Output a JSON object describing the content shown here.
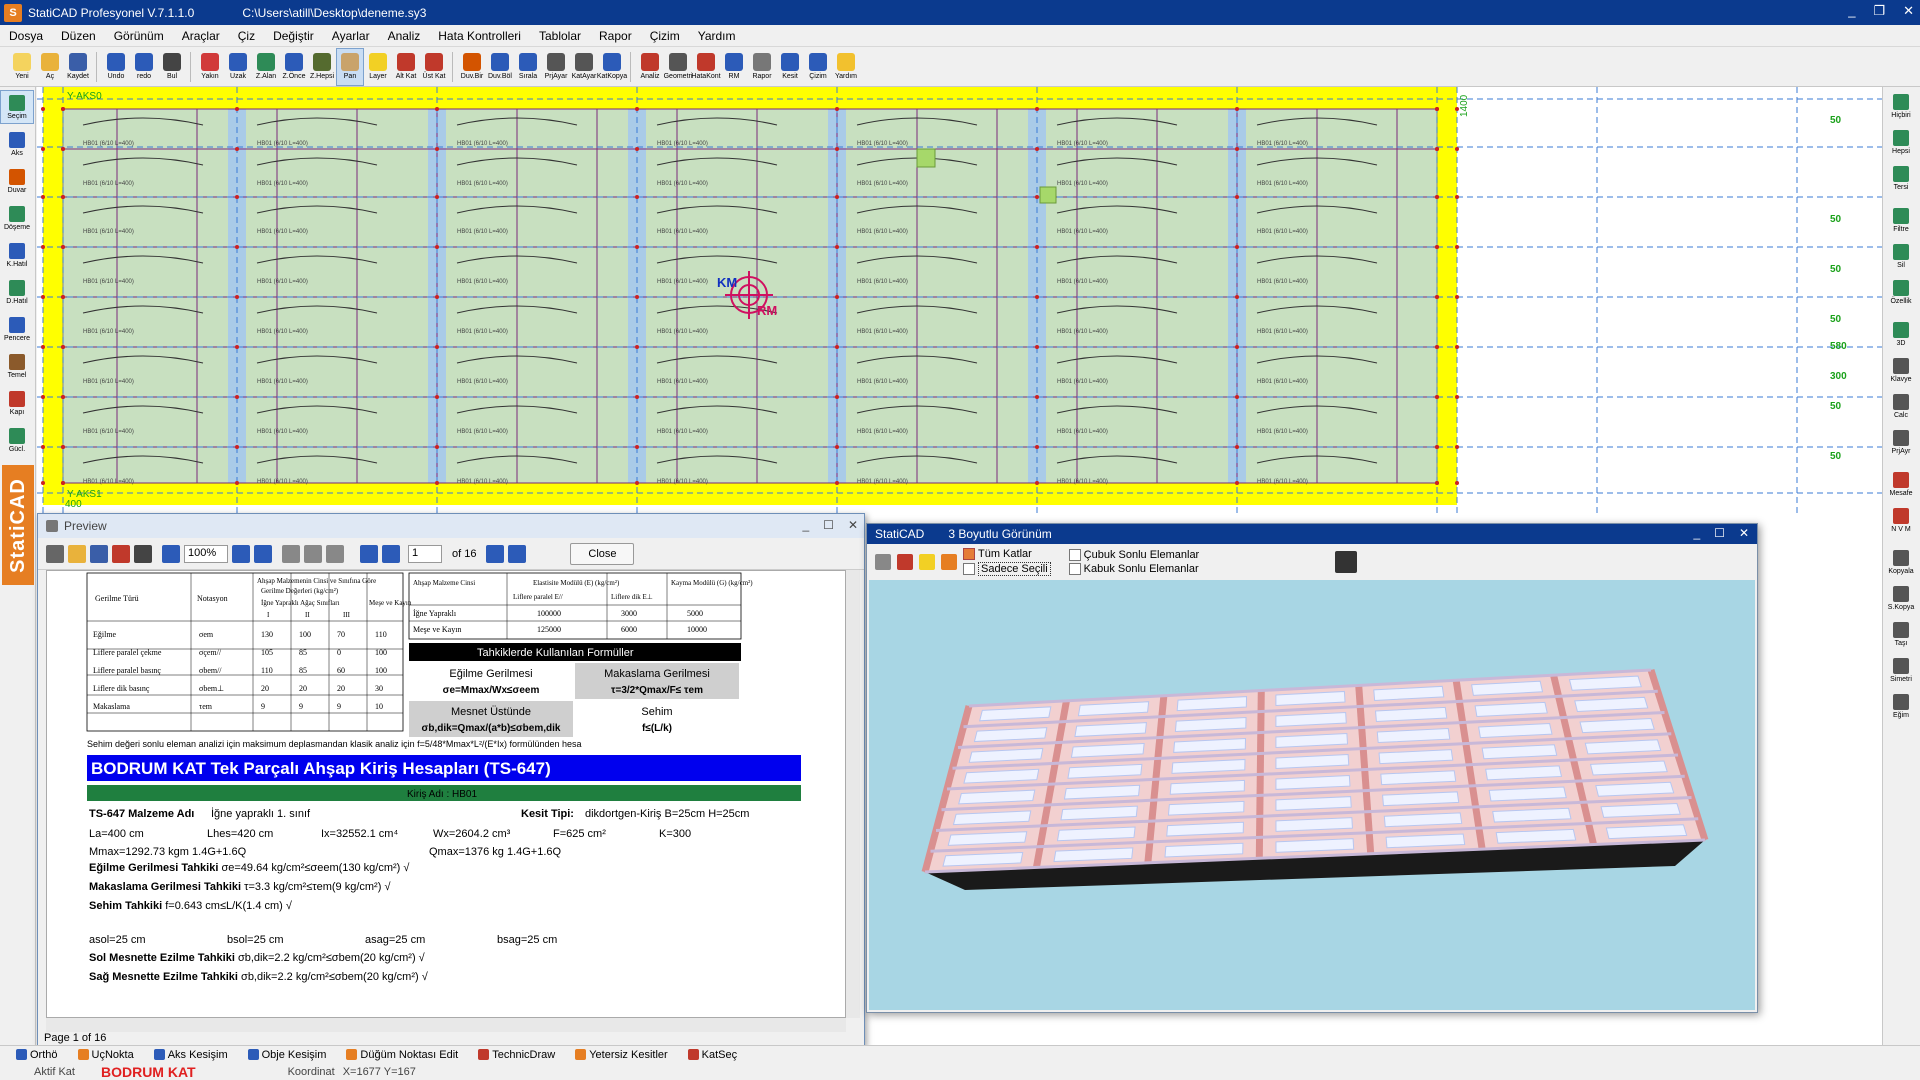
{
  "window": {
    "app_title": "StatiCAD Profesyonel V.7.1.1.0",
    "file_path": "C:\\Users\\atill\\Desktop\\deneme.sy3"
  },
  "menu": [
    "Dosya",
    "Düzen",
    "Görünüm",
    "Araçlar",
    "Çiz",
    "Değiştir",
    "Ayarlar",
    "Analiz",
    "Hata Kontrolleri",
    "Tablolar",
    "Rapor",
    "Çizim",
    "Yardım"
  ],
  "toolbar": [
    {
      "label": "Yeni",
      "icon": "new-file-icon",
      "color": "#f4d35e"
    },
    {
      "label": "Aç",
      "icon": "open-folder-icon",
      "color": "#e9b23b"
    },
    {
      "label": "Kaydet",
      "icon": "save-disk-icon",
      "color": "#3a5ea8"
    },
    {
      "label": "Undo",
      "icon": "undo-icon",
      "color": "#2c5bb8"
    },
    {
      "label": "redo",
      "icon": "redo-icon",
      "color": "#2c5bb8"
    },
    {
      "label": "Bul",
      "icon": "find-icon",
      "color": "#444444"
    },
    {
      "label": "Yakın",
      "icon": "zoom-in-icon",
      "color": "#d13a3a"
    },
    {
      "label": "Uzak",
      "icon": "zoom-out-icon",
      "color": "#2c5bb8"
    },
    {
      "label": "Z.Alan",
      "icon": "zoom-area-icon",
      "color": "#2e8b57"
    },
    {
      "label": "Z.Önce",
      "icon": "zoom-previous-icon",
      "color": "#2c5bb8"
    },
    {
      "label": "Z.Hepsi",
      "icon": "zoom-all-icon",
      "color": "#556b2f"
    },
    {
      "label": "Pan",
      "icon": "pan-hand-icon",
      "color": "#c9a36b"
    },
    {
      "label": "Layer",
      "icon": "layer-bulb-icon",
      "color": "#f2d024"
    },
    {
      "label": "Alt Kat",
      "icon": "lower-floor-icon",
      "color": "#c0392b"
    },
    {
      "label": "Üst Kat",
      "icon": "upper-floor-icon",
      "color": "#c0392b"
    },
    {
      "label": "Duv.Bir",
      "icon": "wall-join-icon",
      "color": "#d35400"
    },
    {
      "label": "Duv.Böl",
      "icon": "wall-split-icon",
      "color": "#2c5bb8"
    },
    {
      "label": "Sırala",
      "icon": "sort-icon",
      "color": "#2c5bb8"
    },
    {
      "label": "PrjAyar",
      "icon": "project-settings-icon",
      "color": "#555555"
    },
    {
      "label": "KatAyar",
      "icon": "floor-settings-icon",
      "color": "#555555"
    },
    {
      "label": "KatKopya",
      "icon": "floor-copy-icon",
      "color": "#2c5bb8"
    },
    {
      "label": "Analiz",
      "icon": "analysis-icon",
      "color": "#c0392b"
    },
    {
      "label": "Geometri",
      "icon": "geometry-icon",
      "color": "#555555"
    },
    {
      "label": "HataKont",
      "icon": "error-check-icon",
      "color": "#c0392b"
    },
    {
      "label": "RM",
      "icon": "rigidity-center-icon",
      "color": "#2c5bb8"
    },
    {
      "label": "Rapor",
      "icon": "report-icon",
      "color": "#777777"
    },
    {
      "label": "Kesit",
      "icon": "section-icon",
      "color": "#2c5bb8"
    },
    {
      "label": "Çizim",
      "icon": "drawing-icon",
      "color": "#2c5bb8"
    },
    {
      "label": "Yardım",
      "icon": "help-icon",
      "color": "#f2c12e"
    }
  ],
  "left_tools": [
    {
      "label": "Seçim",
      "icon": "select-icon",
      "color": "#2e8b57"
    },
    {
      "label": "Aks",
      "icon": "axis-icon",
      "color": "#2c5bb8"
    },
    {
      "label": "Duvar",
      "icon": "wall-icon",
      "color": "#d35400"
    },
    {
      "label": "Döşeme",
      "icon": "slab-icon",
      "color": "#2e8b57"
    },
    {
      "label": "K.Hatıl",
      "icon": "lintel-icon",
      "color": "#2c5bb8"
    },
    {
      "label": "D.Hatıl",
      "icon": "vertical-tie-icon",
      "color": "#2e8b57"
    },
    {
      "label": "Pencere",
      "icon": "window-icon",
      "color": "#2c5bb8"
    },
    {
      "label": "Temel",
      "icon": "foundation-icon",
      "color": "#8b5a2b"
    },
    {
      "label": "Kapı",
      "icon": "door-icon",
      "color": "#c0392b"
    },
    {
      "label": "Gücl.",
      "icon": "strengthen-icon",
      "color": "#2e8b57"
    }
  ],
  "brand_logo_text": "StatiCAD",
  "right_tools": [
    {
      "label": "Hiçbiri",
      "icon": "select-none-icon",
      "color": "#2e8b57"
    },
    {
      "label": "Hepsi",
      "icon": "select-all-icon",
      "color": "#2e8b57"
    },
    {
      "label": "Tersi",
      "icon": "invert-selection-icon",
      "color": "#2e8b57"
    },
    {
      "label": "Filtre",
      "icon": "filter-icon",
      "color": "#2e8b57"
    },
    {
      "label": "Sil",
      "icon": "delete-icon",
      "color": "#2e8b57"
    },
    {
      "label": "Özellik",
      "icon": "properties-icon",
      "color": "#2e8b57"
    },
    {
      "label": "3D",
      "icon": "3d-view-icon",
      "color": "#2e8b57"
    },
    {
      "label": "Klavye",
      "icon": "keyboard-icon",
      "color": "#555555"
    },
    {
      "label": "Calc",
      "icon": "calculator-icon",
      "color": "#555555"
    },
    {
      "label": "PrjAyr",
      "icon": "project-settings-icon",
      "color": "#555555"
    },
    {
      "label": "Mesafe",
      "icon": "distance-icon",
      "color": "#c0392b"
    },
    {
      "label": "N V M",
      "icon": "nvm-diagram-icon",
      "color": "#c0392b"
    },
    {
      "label": "Kopyala",
      "icon": "copy-icon",
      "color": "#555555"
    },
    {
      "label": "S.Kopya",
      "icon": "serial-copy-icon",
      "color": "#555555"
    },
    {
      "label": "Taşı",
      "icon": "move-icon",
      "color": "#555555"
    },
    {
      "label": "Simetri",
      "icon": "mirror-icon",
      "color": "#555555"
    },
    {
      "label": "Eğim",
      "icon": "slope-icon",
      "color": "#555555"
    }
  ],
  "cad": {
    "axis_top_label": "Y-AKS0",
    "axis_bottom_label": "Y-AKS1",
    "dim_left": "400",
    "dim_right": "1400",
    "km_label": "KM",
    "rm_label": "RM",
    "right_dims": [
      "50",
      "50",
      "50",
      "50",
      "580",
      "300",
      "50",
      "50"
    ],
    "beam_label_sample": "HB01 (6/10 L=400)"
  },
  "preview": {
    "title": "Preview",
    "zoom": "100%",
    "page": "1",
    "of_pages": "of 16",
    "close_label": "Close",
    "status": "Page 1 of 16",
    "content": {
      "left_table": {
        "col1": "Gerilme Türü",
        "col2": "Notasyon",
        "col3": "Ahşap Malzemenin Cinsi ve Sınıfına Göre Gerilme Değerleri (kg/cm²)",
        "sub_conifer": "İğne Yapraklı Ağaç Sınıfları",
        "sub_oak": "Meşe ve Kayın",
        "classes": [
          "I",
          "II",
          "III"
        ],
        "rows": [
          [
            "Eğilme",
            "σem",
            "130",
            "100",
            "70",
            "110"
          ],
          [
            "Liflere paralel çekme",
            "σçem//",
            "105",
            "85",
            "0",
            "100"
          ],
          [
            "Liflere paralel basınç",
            "σbem//",
            "110",
            "85",
            "60",
            "100"
          ],
          [
            "Liflere dik basınç",
            "σbem⊥",
            "20",
            "20",
            "20",
            "30"
          ],
          [
            "Makaslama",
            "τem",
            "9",
            "9",
            "9",
            "10"
          ]
        ]
      },
      "right_table": {
        "h1": "Ahşap Malzeme Cinsi",
        "h2": "Elastisite Modülü (E) (kg/cm²)",
        "h2a": "Liflere paralel E//",
        "h2b": "Liflere dik E⊥",
        "h3": "Kayma Modülü (G) (kg/cm²)",
        "rows": [
          [
            "İğne Yapraklı",
            "100000",
            "3000",
            "5000"
          ],
          [
            "Meşe ve Kayın",
            "125000",
            "6000",
            "10000"
          ]
        ]
      },
      "formula_header": "Tahkiklerde Kullanılan Formüller",
      "formulas": [
        {
          "t": "Eğilme Gerilmesi",
          "f": "σe=Mmax/Wx≤σeem"
        },
        {
          "t": "Makaslama Gerilmesi",
          "f": "τ=3/2*Qmax/F≤ τem"
        },
        {
          "t": "Mesnet Üstünde",
          "f": "σb,dik=Qmax/(a*b)≤σbem,dik"
        },
        {
          "t": "Sehim",
          "f": "f≤(L/k)"
        }
      ],
      "note": "Sehim değeri sonlu eleman analizi için maksimum deplasmandan klasik analiz için f=5/48*Mmax*L²/(E*Ix) formülünden hesaplanmıştır.",
      "main_title": "BODRUM KAT Tek Parçalı Ahşap Kiriş Hesapları (TS-647)",
      "beam_name": "Kiriş Adı : HB01",
      "material_label": "TS-647 Malzeme Adı",
      "material_value": "İğne yapraklı 1. sınıf",
      "section_label": "Kesit Tipi:",
      "section_value": "dikdortgen-Kiriş B=25cm H=25cm",
      "line1": [
        "La=400 cm",
        "Lhes=420 cm",
        "Ix=32552.1 cm⁴",
        "Wx=2604.2 cm³",
        "F=625 cm²",
        "K=300"
      ],
      "line2a": "Mmax=1292.73 kgm   1.4G+1.6Q",
      "line2b": "Qmax=1376 kg   1.4G+1.6Q",
      "checks": [
        {
          "b": "Eğilme Gerilmesi Tahkiki",
          "t": "  σe=49.64 kg/cm²≤σeem(130  kg/cm²) √"
        },
        {
          "b": "Makaslama Gerilmesi Tahkiki",
          "t": " τ=3.3 kg/cm²≤τem(9  kg/cm²) √"
        },
        {
          "b": "Sehim Tahkiki",
          "t": " f=0.643 cm≤L/K(1.4  cm) √"
        }
      ],
      "supports": [
        "asol=25 cm",
        "bsol=25 cm",
        "asag=25 cm",
        "bsag=25 cm"
      ],
      "support_checks": [
        {
          "b": "Sol Mesnette Ezilme Tahkiki",
          "t": "  σb,dik=2.2 kg/cm²≤σbem(20  kg/cm²) √"
        },
        {
          "b": "Sağ Mesnette Ezilme Tahkiki",
          "t": "  σb,dik=2.2 kg/cm²≤σbem(20  kg/cm²) √"
        }
      ]
    }
  },
  "view3d": {
    "app": "StatiCAD",
    "title": "3 Boyutlu Görünüm",
    "opt_all_floors": "Tüm Katlar",
    "opt_selected_only": "Sadece Seçili",
    "opt_bar_fe": "Çubuk Sonlu Elemanlar",
    "opt_shell_fe": "Kabuk Sonlu Elemanlar"
  },
  "statusbar": [
    {
      "label": "Orthö",
      "icon": "ortho-icon",
      "color": "#2c5bb8"
    },
    {
      "label": "UçNokta",
      "icon": "endpoint-snap-icon",
      "color": "#e67e22"
    },
    {
      "label": "Aks Kesişim",
      "icon": "axis-intersection-icon",
      "color": "#2c5bb8"
    },
    {
      "label": "Obje Kesişim",
      "icon": "object-intersection-icon",
      "color": "#2c5bb8"
    },
    {
      "label": "Düğüm Noktası Edit",
      "icon": "node-edit-icon",
      "color": "#e67e22"
    },
    {
      "label": "TechnicDraw",
      "icon": "technic-draw-icon",
      "color": "#c0392b"
    },
    {
      "label": "Yetersiz Kesitler",
      "icon": "insufficient-sections-icon",
      "color": "#e67e22"
    },
    {
      "label": "KatSeç",
      "icon": "floor-select-icon",
      "color": "#c0392b"
    }
  ],
  "info": {
    "active_floor_label": "Aktif Kat",
    "active_floor_value": "BODRUM KAT",
    "coord_label": "Koordinat",
    "coord_value": "X=1677    Y=167"
  }
}
